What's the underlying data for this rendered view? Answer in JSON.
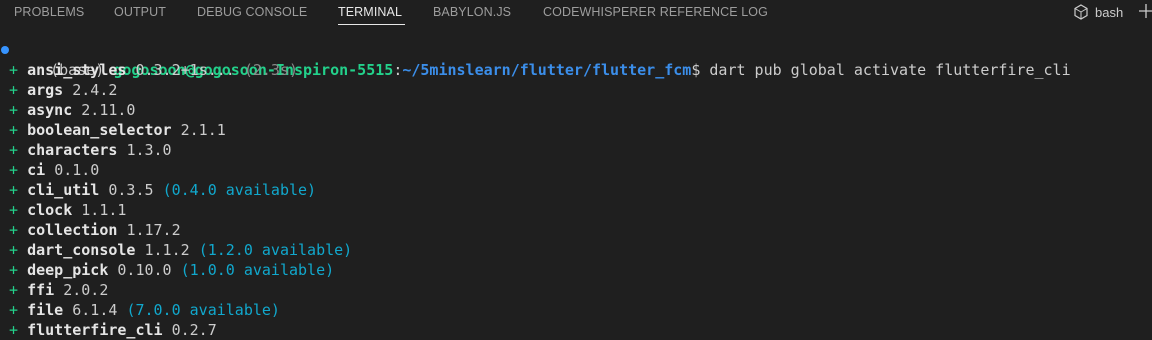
{
  "panel": {
    "tabs": [
      "PROBLEMS",
      "OUTPUT",
      "DEBUG CONSOLE",
      "TERMINAL",
      "BABYLON.JS",
      "CODEWHISPERER REFERENCE LOG"
    ],
    "active_tab": "TERMINAL",
    "shell_label": "bash"
  },
  "terminal": {
    "prompt": {
      "env": "(base) ",
      "user": "gogosoon@gogosoon-Inspiron-5515",
      "colon": ":",
      "path": "~/5minslearn/flutter/flutter_fcm",
      "symbol": "$ ",
      "command": "dart pub global activate flutterfire_cli"
    },
    "packages": [
      {
        "name": "ansi_styles",
        "version": "0.3.2+1",
        "extra": "s...",
        "note": "(2.3s)"
      },
      {
        "name": "args",
        "version": "2.4.2"
      },
      {
        "name": "async",
        "version": "2.11.0"
      },
      {
        "name": "boolean_selector",
        "version": "2.1.1"
      },
      {
        "name": "characters",
        "version": "1.3.0"
      },
      {
        "name": "ci",
        "version": "0.1.0"
      },
      {
        "name": "cli_util",
        "version": "0.3.5",
        "available": "(0.4.0 available)"
      },
      {
        "name": "clock",
        "version": "1.1.1"
      },
      {
        "name": "collection",
        "version": "1.17.2"
      },
      {
        "name": "dart_console",
        "version": "1.1.2",
        "available": "(1.2.0 available)"
      },
      {
        "name": "deep_pick",
        "version": "0.10.0",
        "available": "(1.0.0 available)"
      },
      {
        "name": "ffi",
        "version": "2.0.2"
      },
      {
        "name": "file",
        "version": "6.1.4",
        "available": "(7.0.0 available)"
      },
      {
        "name": "flutterfire_cli",
        "version": "0.2.7"
      }
    ]
  },
  "colors": {
    "background": "#1f1f1f",
    "green": "#23d18b",
    "blue": "#3b8eea",
    "cyan": "#11a8cd"
  }
}
